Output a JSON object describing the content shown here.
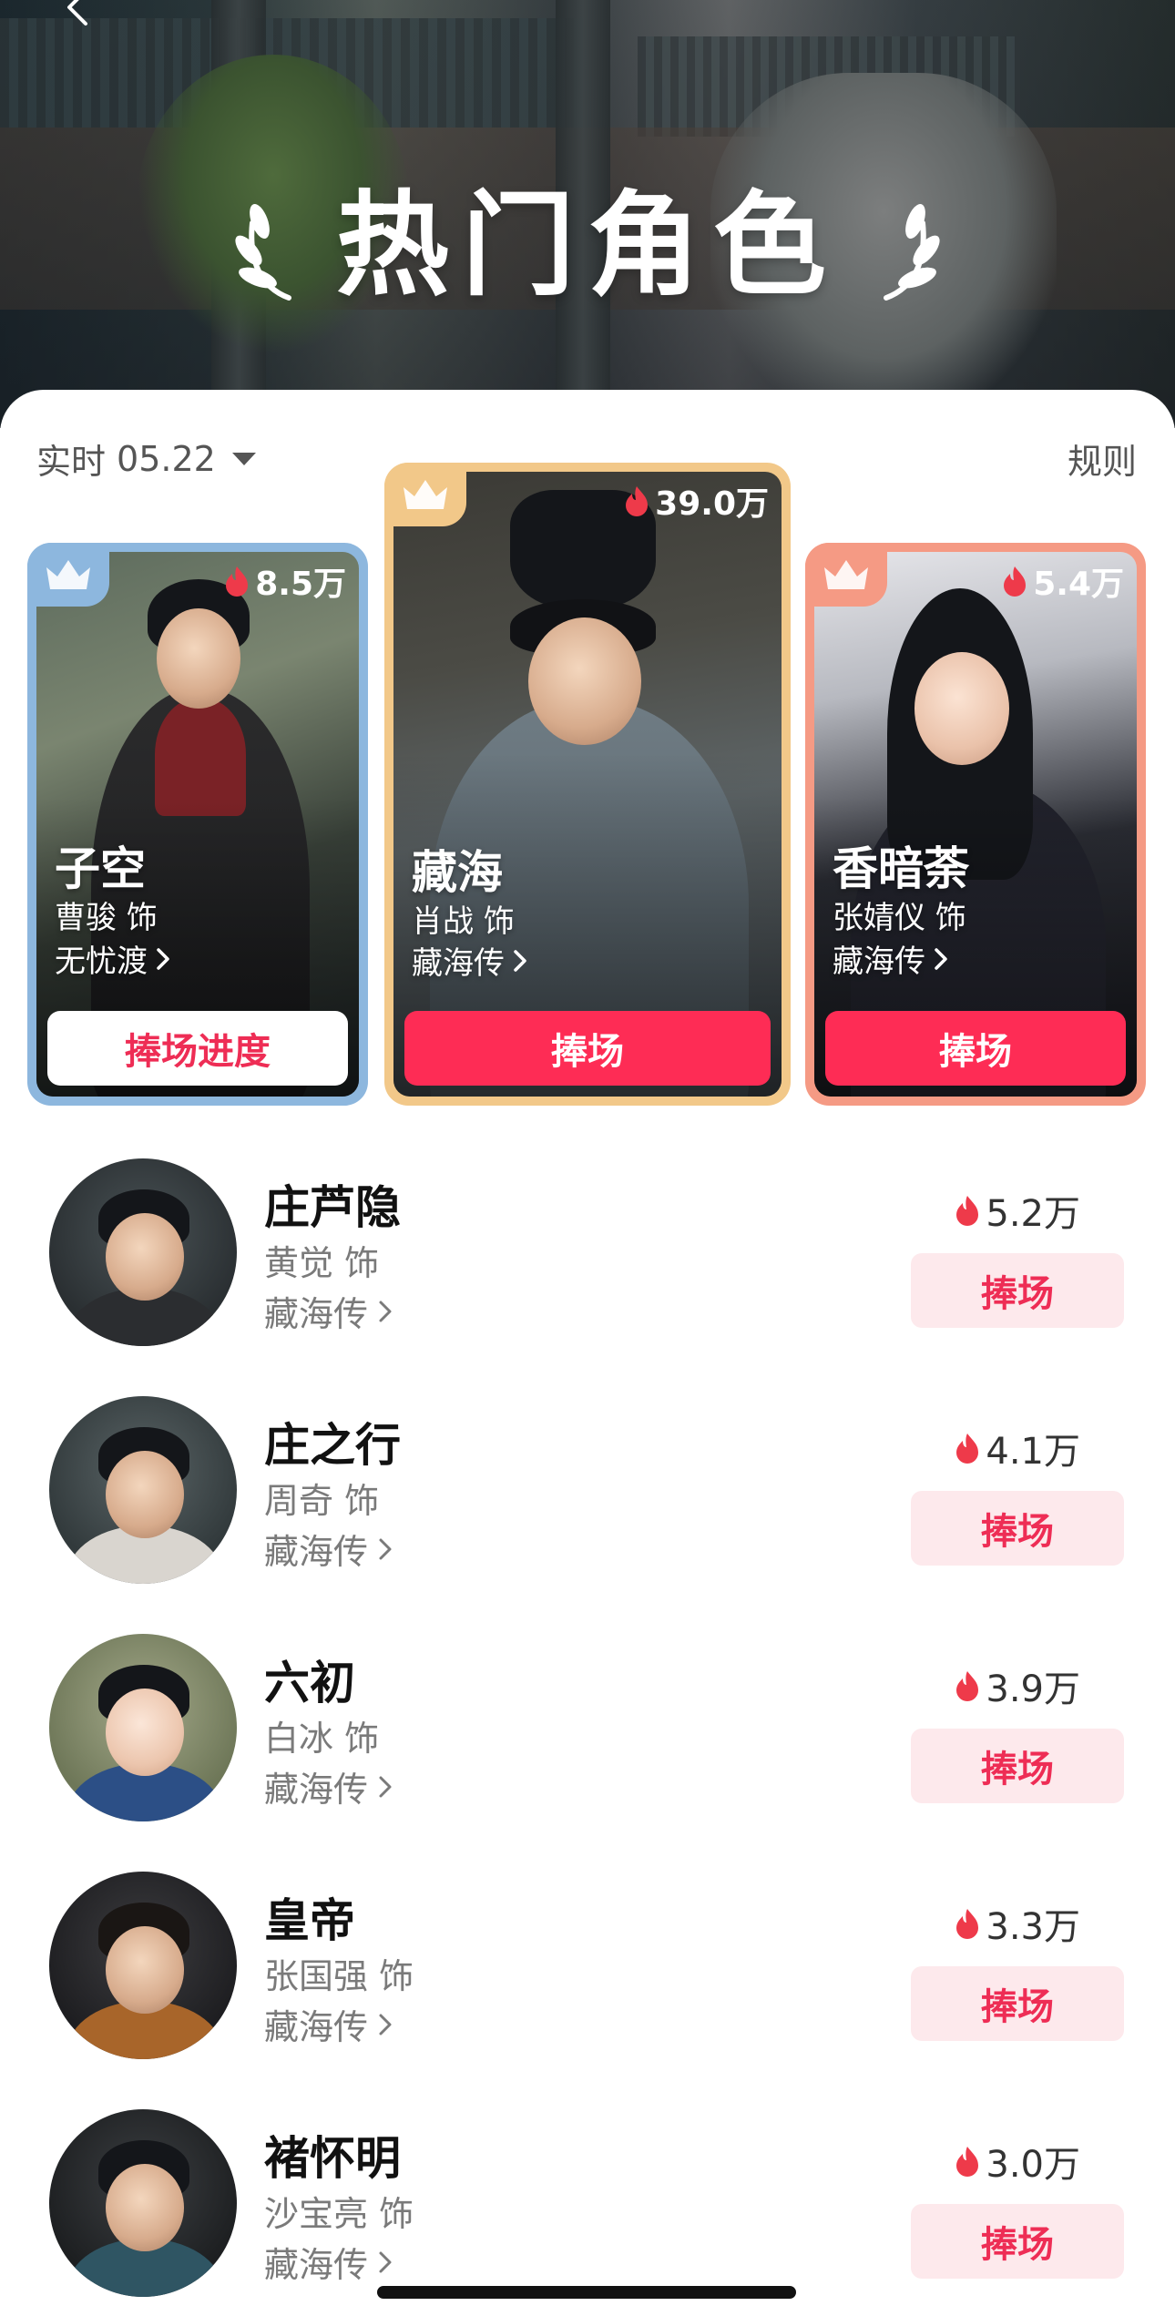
{
  "header": {
    "title": "热门角色"
  },
  "filter": {
    "label": "实时",
    "date": "05.22",
    "rules_label": "规则"
  },
  "podium": [
    {
      "rank": 2,
      "name": "子空",
      "actor": "曹骏 饰",
      "show": "无忧渡",
      "heat": "8.5万",
      "button": "捧场进度",
      "crown_color": "#8db7de"
    },
    {
      "rank": 1,
      "name": "藏海",
      "actor": "肖战 饰",
      "show": "藏海传",
      "heat": "39.0万",
      "button": "捧场",
      "crown_color": "#f2c889"
    },
    {
      "rank": 3,
      "name": "香暗荼",
      "actor": "张婧仪 饰",
      "show": "藏海传",
      "heat": "5.4万",
      "button": "捧场",
      "crown_color": "#f59a84"
    }
  ],
  "ranking": [
    {
      "name": "庄芦隐",
      "actor": "黄觉 饰",
      "show": "藏海传",
      "heat": "5.2万",
      "button": "捧场"
    },
    {
      "name": "庄之行",
      "actor": "周奇 饰",
      "show": "藏海传",
      "heat": "4.1万",
      "button": "捧场"
    },
    {
      "name": "六初",
      "actor": "白冰 饰",
      "show": "藏海传",
      "heat": "3.9万",
      "button": "捧场"
    },
    {
      "name": "皇帝",
      "actor": "张国强 饰",
      "show": "藏海传",
      "heat": "3.3万",
      "button": "捧场"
    },
    {
      "name": "褚怀明",
      "actor": "沙宝亮 饰",
      "show": "藏海传",
      "heat": "3.0万",
      "button": "捧场"
    }
  ],
  "colors": {
    "accent": "#fe2c55",
    "accent_soft": "#fde9ec",
    "flame": "#ee3a4a"
  },
  "icons": [
    "back-icon",
    "laurel-icon",
    "caret-down-icon",
    "crown-icon",
    "flame-icon",
    "chevron-right-icon"
  ]
}
